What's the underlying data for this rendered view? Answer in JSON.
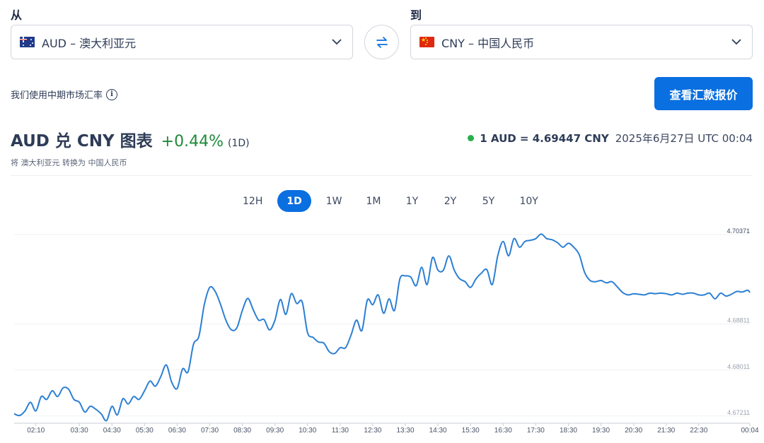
{
  "from": {
    "label": "从",
    "currency": "AUD – 澳大利亚元"
  },
  "to": {
    "label": "到",
    "currency": "CNY – 中国人民币"
  },
  "midrate_note": "我们使用中期市场汇率",
  "cta_label": "查看汇款报价",
  "header": {
    "title": "AUD 兑 CNY 图表",
    "change": "+0.44%",
    "period": "(1D)",
    "subtitle": "将 澳大利亚元 转换为 中国人民币",
    "rate": "1 AUD = 4.69447 CNY",
    "timestamp": "2025年6月27日 UTC 00:04"
  },
  "periods": [
    "12H",
    "1D",
    "1W",
    "1M",
    "1Y",
    "2Y",
    "5Y",
    "10Y"
  ],
  "active_period": "1D",
  "colors": {
    "accent": "#0a6fe0",
    "line": "#2b7fd4",
    "positive": "#1f8a3a"
  },
  "chart_data": {
    "type": "line",
    "x_tick_labels": [
      "02:10",
      "03:30",
      "04:30",
      "05:30",
      "06:30",
      "07:30",
      "08:30",
      "09:30",
      "10:30",
      "11:30",
      "12:30",
      "13:30",
      "14:30",
      "15:30",
      "16:30",
      "17:30",
      "18:30",
      "19:30",
      "20:30",
      "21:30",
      "22:30",
      "00:04"
    ],
    "y_tick_labels": [
      "4.70371",
      "4.68811",
      "4.68011",
      "4.67211"
    ],
    "ylim": [
      4.6711,
      4.7037
    ],
    "x": [
      "01:30",
      "01:40",
      "01:50",
      "02:00",
      "02:10",
      "02:20",
      "02:30",
      "02:40",
      "02:50",
      "03:00",
      "03:10",
      "03:20",
      "03:30",
      "03:40",
      "03:50",
      "04:00",
      "04:10",
      "04:20",
      "04:30",
      "04:40",
      "04:50",
      "05:00",
      "05:10",
      "05:20",
      "05:30",
      "05:40",
      "05:50",
      "06:00",
      "06:10",
      "06:20",
      "06:30",
      "06:40",
      "06:50",
      "07:00",
      "07:10",
      "07:20",
      "07:30",
      "07:40",
      "07:50",
      "08:00",
      "08:10",
      "08:20",
      "08:30",
      "08:40",
      "08:50",
      "09:00",
      "09:10",
      "09:20",
      "09:30",
      "09:40",
      "09:50",
      "10:00",
      "10:10",
      "10:20",
      "10:30",
      "10:40",
      "10:50",
      "11:00",
      "11:10",
      "11:20",
      "11:30",
      "11:40",
      "11:50",
      "12:00",
      "12:10",
      "12:20",
      "12:30",
      "12:40",
      "12:50",
      "13:00",
      "13:10",
      "13:20",
      "13:30",
      "13:40",
      "13:50",
      "14:00",
      "14:10",
      "14:20",
      "14:30",
      "14:40",
      "14:50",
      "15:00",
      "15:10",
      "15:20",
      "15:30",
      "15:40",
      "15:50",
      "16:00",
      "16:10",
      "16:20",
      "16:30",
      "16:40",
      "16:50",
      "17:00",
      "17:10",
      "17:20",
      "17:30",
      "17:40",
      "17:50",
      "18:00",
      "18:10",
      "18:20",
      "18:30",
      "18:40",
      "18:50",
      "19:00",
      "19:10",
      "19:20",
      "19:30",
      "19:40",
      "19:50",
      "20:00",
      "20:10",
      "20:20",
      "20:30",
      "20:40",
      "20:50",
      "21:00",
      "21:10",
      "21:20",
      "21:30",
      "21:40",
      "21:50",
      "22:00",
      "22:10",
      "22:20",
      "22:30",
      "22:40",
      "22:50",
      "23:00",
      "23:10",
      "23:20",
      "23:30",
      "23:40",
      "23:50",
      "00:00",
      "00:04"
    ],
    "y": [
      4.6725,
      4.6722,
      4.673,
      4.6745,
      4.673,
      4.6755,
      4.675,
      4.6765,
      4.6755,
      4.677,
      4.6768,
      4.675,
      4.6745,
      4.6728,
      4.6738,
      4.6733,
      4.6725,
      4.6713,
      4.6738,
      4.6723,
      4.6751,
      4.6742,
      4.6755,
      4.675,
      4.6765,
      4.6782,
      4.6773,
      4.679,
      4.681,
      4.678,
      4.6769,
      4.6803,
      4.6798,
      4.6846,
      4.686,
      4.6915,
      4.6945,
      4.6938,
      4.6915,
      4.6887,
      4.6871,
      4.6875,
      4.6905,
      4.6926,
      4.6906,
      4.6888,
      4.6889,
      4.6871,
      4.6888,
      4.6924,
      4.6898,
      4.6934,
      4.6917,
      4.692,
      4.6866,
      4.6858,
      4.685,
      4.6848,
      4.6833,
      4.683,
      4.684,
      4.684,
      4.6862,
      4.6888,
      4.687,
      4.6923,
      4.6915,
      4.6932,
      4.69,
      4.6925,
      4.6905,
      4.696,
      4.6965,
      4.6963,
      4.6948,
      4.698,
      4.695,
      4.6997,
      4.6975,
      4.6975,
      4.7,
      4.6975,
      4.696,
      4.6955,
      4.6945,
      4.696,
      4.697,
      4.6976,
      4.695,
      4.7,
      4.7025,
      4.7,
      4.703,
      4.7015,
      4.7025,
      4.7027,
      4.703,
      4.7038,
      4.703,
      4.7028,
      4.7023,
      4.7015,
      4.7022,
      4.7015,
      4.7002,
      4.6971,
      4.6957,
      4.6955,
      4.6957,
      4.6953,
      4.6955,
      4.6946,
      4.6936,
      4.6932,
      4.6934,
      4.6933,
      4.6932,
      4.6935,
      4.6934,
      4.6935,
      4.6934,
      4.6932,
      4.6935,
      4.6933,
      4.6935,
      4.6935,
      4.6932,
      4.6932,
      4.6935,
      4.6925,
      4.6935,
      4.693,
      4.6933,
      4.6938,
      4.6937,
      4.694,
      4.6936,
      4.6946
    ],
    "grid": true
  }
}
